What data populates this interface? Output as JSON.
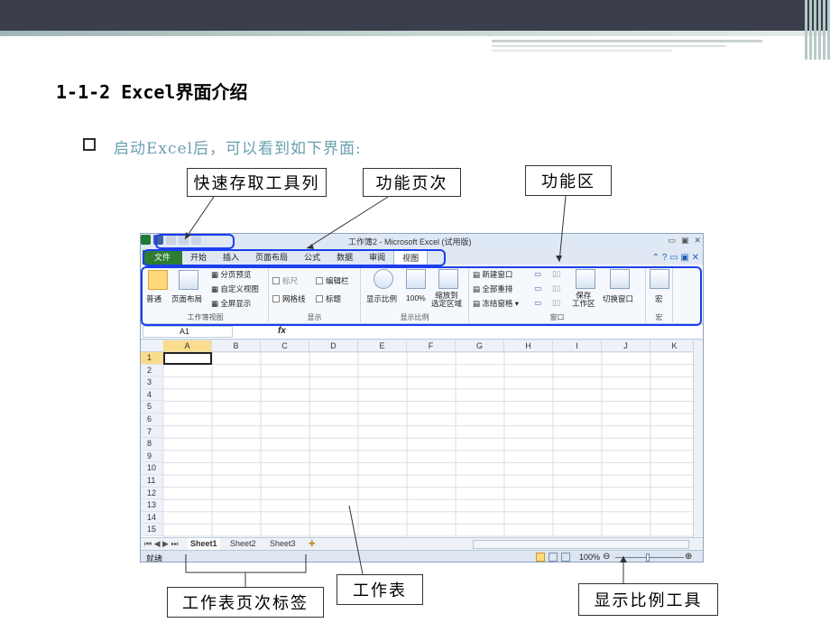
{
  "slide": {
    "title": "1-1-2 Excel界面介绍",
    "bullet": "启动Excel后，可以看到如下界面:"
  },
  "callouts": {
    "quick_access": "快速存取工具列",
    "tabs": "功能页次",
    "ribbon": "功能区",
    "sheet_tabs": "工作表页次标签",
    "worksheet": "工作表",
    "zoom_tool": "显示比例工具"
  },
  "excel": {
    "caption": "工作簿2 - Microsoft Excel (试用版)",
    "tabs": [
      "文件",
      "开始",
      "插入",
      "页面布局",
      "公式",
      "数据",
      "审阅",
      "视图"
    ],
    "active_tab": "视图",
    "ribbon": {
      "normal": "普通",
      "page_layout": "页面布局",
      "page_break": "分页预览",
      "custom_view": "自定义视图",
      "full_screen": "全屏显示",
      "group_workbook_views": "工作簿视图",
      "ruler": "标尺",
      "formula_bar": "编辑栏",
      "gridlines": "网格线",
      "headings": "标题",
      "group_show": "显示",
      "zoom": "显示比例",
      "zoom_100": "100%",
      "zoom_selection": "缩放到\n选定区域",
      "group_zoom": "显示比例",
      "new_window": "新建窗口",
      "arrange_all": "全部重排",
      "freeze_panes": "冻结窗格",
      "save_workspace": "保存\n工作区",
      "switch_windows": "切换窗口",
      "group_window": "窗口",
      "macros": "宏",
      "group_macros": "宏"
    },
    "name_box": "A1",
    "fx": "fx",
    "columns": [
      "A",
      "B",
      "C",
      "D",
      "E",
      "F",
      "G",
      "H",
      "I",
      "J",
      "K"
    ],
    "rows": [
      "1",
      "2",
      "3",
      "4",
      "5",
      "6",
      "7",
      "8",
      "9",
      "10",
      "11",
      "12",
      "13",
      "14",
      "15"
    ],
    "sheets": [
      "Sheet1",
      "Sheet2",
      "Sheet3"
    ],
    "status": "就绪",
    "zoom_level": "100%"
  }
}
